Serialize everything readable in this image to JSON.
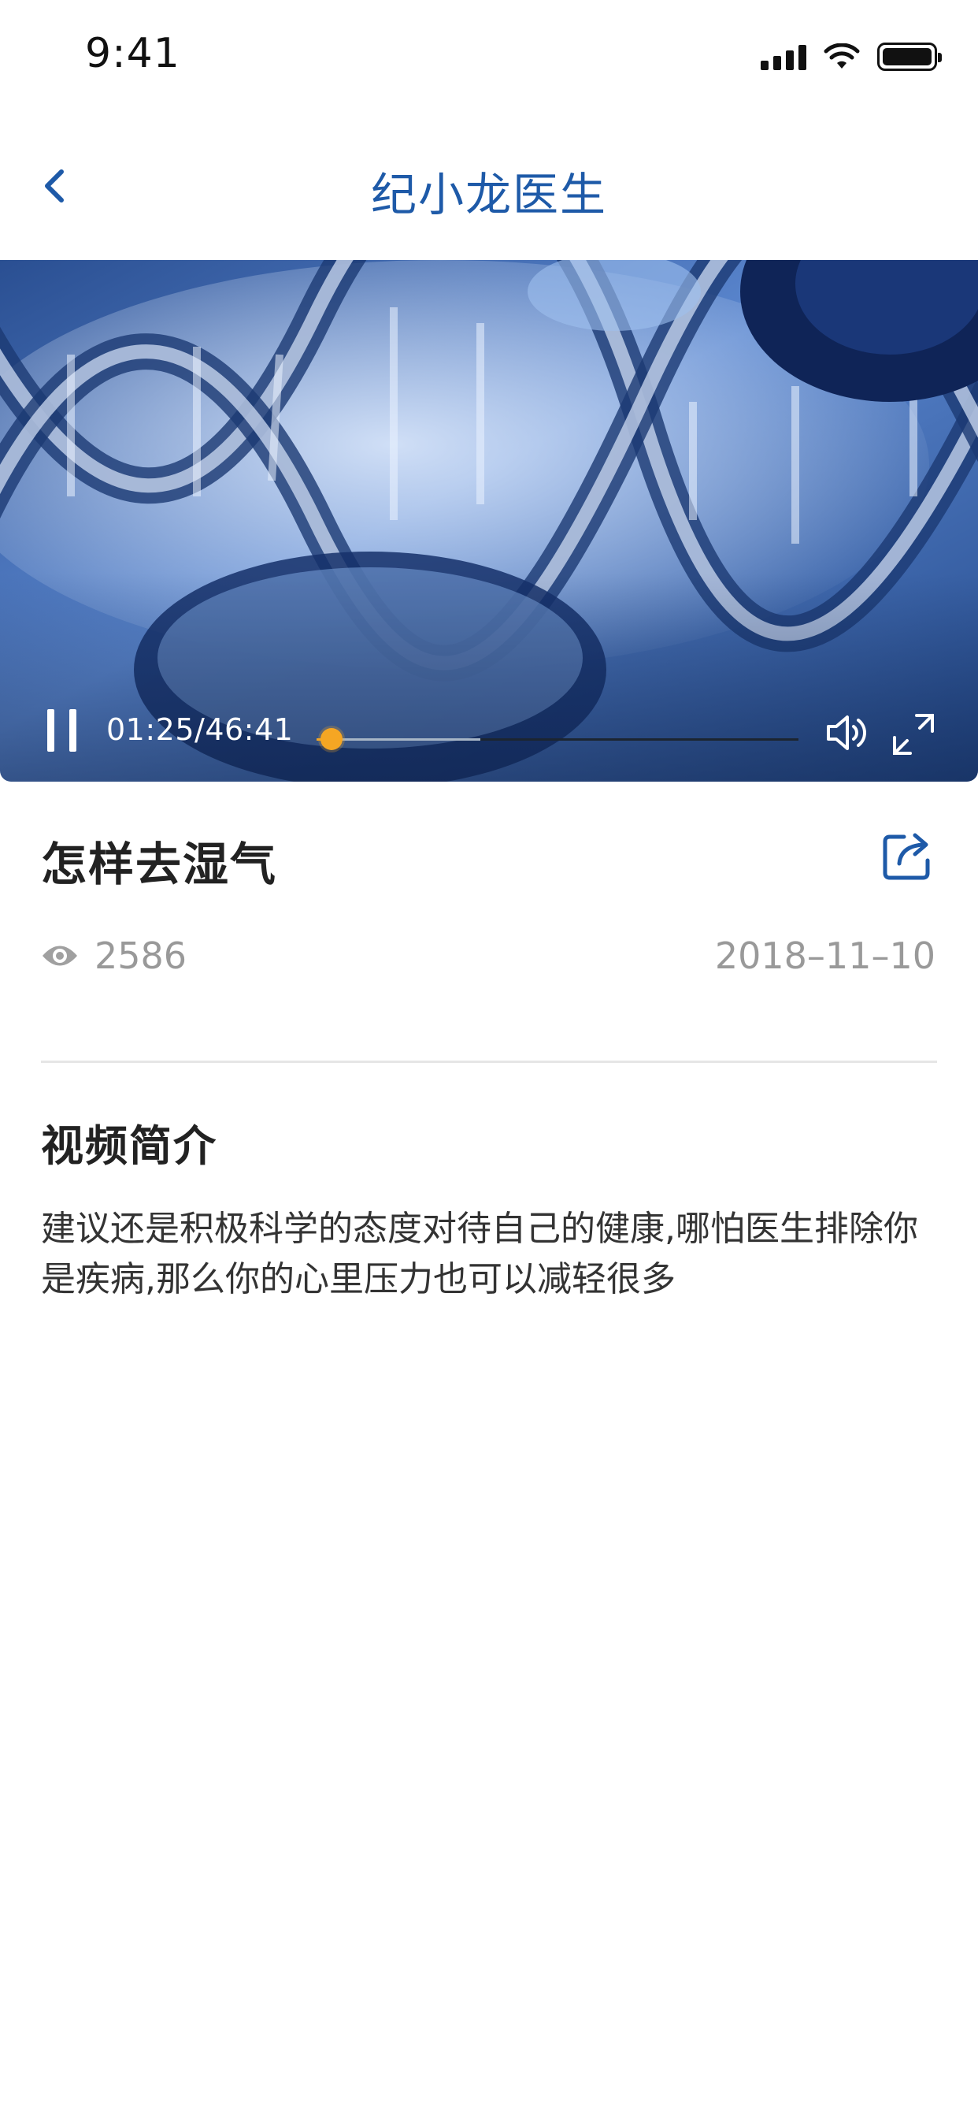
{
  "status_bar": {
    "time": "9:41",
    "icons": [
      "signal-icon",
      "wifi-icon",
      "battery-icon"
    ]
  },
  "nav": {
    "title": "纪小龙医生",
    "back_icon": "chevron-left-icon"
  },
  "video": {
    "time_display": "01:25/46:41",
    "current_time": "01:25",
    "duration": "46:41",
    "progress": 0.0303,
    "buffered": 0.34,
    "colors": {
      "accent": "#f5a623",
      "art_base": "#4a76c0"
    },
    "icons": [
      "pause-icon",
      "volume-icon",
      "fullscreen-icon"
    ]
  },
  "article": {
    "title": "怎样去湿气",
    "views": "2586",
    "date": "2018–11–10",
    "share_icon": "share-icon",
    "views_icon": "eye-icon"
  },
  "intro": {
    "heading": "视频简介",
    "text": "建议还是积极科学的态度对待自己的健康,哪怕医生排除你是疾病,那么你的心里压力也可以减轻很多"
  },
  "colors": {
    "brand": "#1e5aa8",
    "muted_text": "#999999"
  }
}
